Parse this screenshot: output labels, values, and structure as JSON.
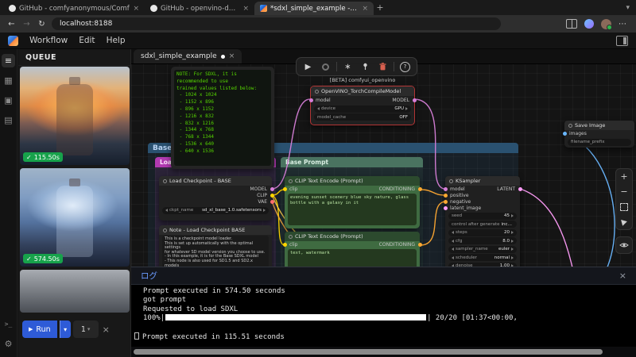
{
  "browser": {
    "tabs": [
      {
        "title": "GitHub - comfyanonymous/Comf"
      },
      {
        "title": "GitHub - openvino-dev-samples/"
      },
      {
        "title": "*sdxl_simple_example - ComfyUI"
      }
    ],
    "url": "localhost:8188"
  },
  "menu": {
    "items": [
      "Workflow",
      "Edit",
      "Help"
    ]
  },
  "queue_panel": {
    "title": "QUEUE",
    "items": [
      {
        "status": "✓",
        "duration": "115.50s"
      },
      {
        "status": "✓",
        "duration": "574.50s"
      }
    ],
    "run_label": "Run",
    "batch_count": "1"
  },
  "canvas": {
    "tab": {
      "title": "sdxl_simple_example"
    },
    "beta_badge": "[BETA] comfyui_openvino",
    "groups": {
      "base": "Base",
      "load_model": "Load in BASE SDXL Model",
      "base_prompt": "Base Prompt"
    },
    "nodes": {
      "sdxl_note": {
        "text": "NOTE: For SDXL, it is recommended to use\ntrained values listed below:\n - 1024 x 1024\n - 1152 x 896\n - 896 x 1152\n - 1216 x 832\n - 832 x 1216\n - 1344 x 768\n - 768 x 1344\n - 1536 x 640\n - 640 x 1536"
      },
      "openvino": {
        "title": "OpenVINO_TorchCompileModel",
        "input_model": "model",
        "output_model": "MODEL",
        "device_label": "device",
        "device_value": "GPU",
        "cache_label": "model_cache",
        "cache_value": "OFF"
      },
      "load_checkpoint": {
        "title": "Load Checkpoint - BASE",
        "out_model": "MODEL",
        "out_clip": "CLIP",
        "out_vae": "VAE",
        "ckpt_label": "ckpt_name",
        "ckpt_value": "sd_xl_base_1.0.safetensors"
      },
      "checkpoint_note": {
        "title": "Note - Load Checkpoint BASE",
        "text": "This is a checkpoint model loader.\nThis is set up automatically with the optimal settings\nfor whatever SD model version you choose to use.\n- In this example, it is for the Base SDXL model\n- This node is also used for SD1.5 and SD2.x models\nNOTE: When loading in another person's workflow, be sure\nto manually choose your own ckpt model. This also..."
      },
      "cl_pos": {
        "title": "CLIP Text Encode (Prompt)",
        "input": "clip",
        "output": "CONDITIONING",
        "text": "evening sunset scenery blue sky nature, glass bottle with a galaxy in it"
      },
      "cl_neg": {
        "title": "CLIP Text Encode (Prompt)",
        "input": "clip",
        "output": "CONDITIONING",
        "text": "text, watermark"
      },
      "ksampler": {
        "title": "KSampler",
        "in_model": "model",
        "in_positive": "positive",
        "in_negative": "negative",
        "in_latent": "latent_image",
        "out_latent": "LATENT",
        "widgets": [
          {
            "label": "seed",
            "value": "45"
          },
          {
            "label": "control after generate",
            "value": "increment"
          },
          {
            "label": "steps",
            "value": "20"
          },
          {
            "label": "cfg",
            "value": "8.0"
          },
          {
            "label": "sampler_name",
            "value": "euler"
          },
          {
            "label": "scheduler",
            "value": "normal"
          },
          {
            "label": "denoise",
            "value": "1.00"
          }
        ]
      },
      "save_image": {
        "title": "Save Image",
        "input": "images",
        "widget_label": "filename_prefix"
      }
    }
  },
  "log": {
    "title": "ログ",
    "line1": "Prompt executed in 574.50 seconds",
    "line2": "got prompt",
    "line3": "Requested to load SDXL",
    "progress_prefix": "100%|",
    "progress_suffix": "| 20/20 [01:37<00:00,",
    "line5": "Prompt executed in 115.51 seconds"
  },
  "icons": {
    "close": "×",
    "new_tab": "+",
    "back": "←",
    "forward": "→",
    "refresh": "↻",
    "more": "⋯",
    "chevron": "▾",
    "play": "▶",
    "check": "✓",
    "plus": "+",
    "minus": "−",
    "help": "?",
    "snap": "∗",
    "queue_tab": "≡",
    "node_library": "▦",
    "model_library": "▣",
    "workflows": "▤",
    "terminal": ">_",
    "settings": "⚙"
  },
  "colors": {
    "run_button": "#2e5bd7",
    "success_badge": "#17a24b",
    "log_title": "#6b9bff",
    "wire_model": "#d77fd8",
    "wire_clip": "#ffd500",
    "wire_conditioning": "#ffa931",
    "wire_latent": "#ff9cf9",
    "wire_image": "#6ab7ff",
    "wire_vae": "#ffb13f"
  }
}
